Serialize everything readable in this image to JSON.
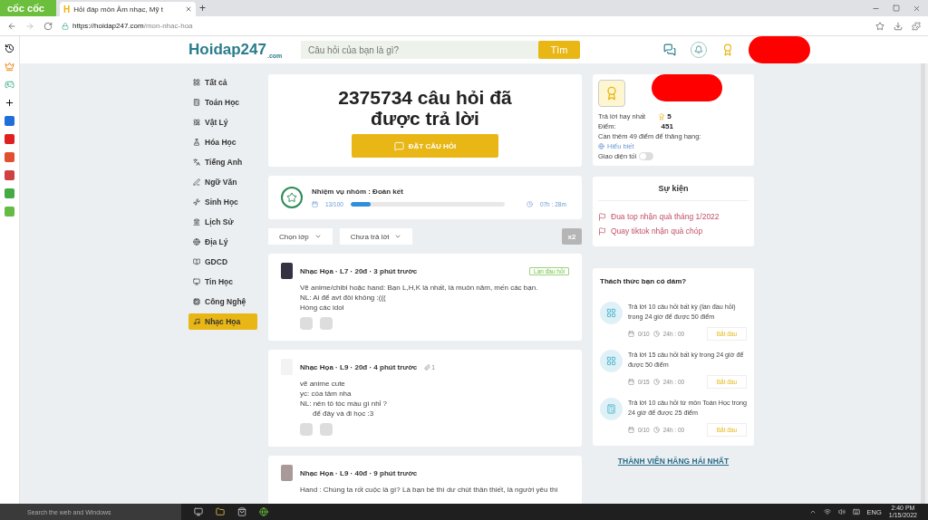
{
  "browser": {
    "brand": "cốc cốc",
    "favicon": "H",
    "tab_title": "Hỏi đáp môn Âm nhạc, Mỹ t",
    "new_tab": "+",
    "url_host": "https://hoidap247.com",
    "url_path": "/mon-nhac-hoa"
  },
  "header": {
    "logo": "Hoidap247",
    "logo_sub": ".com",
    "search_placeholder": "Câu hỏi của bạn là gì?",
    "search_button": "Tìm"
  },
  "nav": [
    {
      "label": "Tất cả",
      "selected": false
    },
    {
      "label": "Toán Học",
      "selected": false
    },
    {
      "label": "Vật Lý",
      "selected": false
    },
    {
      "label": "Hóa Học",
      "selected": false
    },
    {
      "label": "Tiếng Anh",
      "selected": false
    },
    {
      "label": "Ngữ Văn",
      "selected": false
    },
    {
      "label": "Sinh Học",
      "selected": false
    },
    {
      "label": "Lịch Sử",
      "selected": false
    },
    {
      "label": "Địa Lý",
      "selected": false
    },
    {
      "label": "GDCD",
      "selected": false
    },
    {
      "label": "Tin Học",
      "selected": false
    },
    {
      "label": "Công Nghệ",
      "selected": false
    },
    {
      "label": "Nhạc Họa",
      "selected": true
    }
  ],
  "stats": {
    "headline": "2375734 câu hỏi đã được trả lời",
    "ask_button": "ĐẶT CÂU HỎI"
  },
  "mission": {
    "title": "Nhiệm vụ nhóm : Đoàn kết",
    "progress": "13/100",
    "level": 0.13,
    "time": "07h : 28m"
  },
  "filters": [
    {
      "label": "Chọn lớp"
    },
    {
      "label": "Chưa trả lời"
    }
  ],
  "multiplier": "x2",
  "posts": [
    {
      "meta": "Nhạc Họa · L7 · 20đ · 3 phút trước",
      "badge": "Lần đầu hỏi",
      "lines": [
        {
          "text": "Vẽ anime/chibi hoặc hand: Bạn L,H,K là nhất, là muôn năm, mến các bạn.",
          "indent": false
        },
        {
          "text": "NL: Ai để avt đôi không :(((",
          "indent": false
        },
        {
          "text": "Hóng các idol",
          "indent": false
        }
      ],
      "reactions": [
        {
          "kind": "sticker"
        },
        {
          "kind": "sticker"
        }
      ]
    },
    {
      "meta": "Nhạc Họa · L9 · 20đ · 4 phút trước",
      "attachments": "1",
      "lines": [
        {
          "text": "vẽ anime cute",
          "indent": false
        },
        {
          "text": "yc: cóa tâm nha",
          "indent": false
        },
        {
          "text": "NL: nên tô tóc màu gì nhỉ ?",
          "indent": false
        },
        {
          "text": "để đây và đi học :3",
          "indent": true
        }
      ],
      "reactions": [
        {
          "kind": "sticker"
        },
        {
          "kind": "sticker"
        }
      ]
    },
    {
      "meta": "Nhạc Họa · L9 · 40đ · 9 phút trước",
      "lines": [
        {
          "text": "Hand : Chúng ta rốt cuộc là gì? Là bạn bè thì dư chút thân thiết, là người yêu thì",
          "indent": false
        }
      ]
    }
  ],
  "profile": {
    "best_label": "Trả lời hay nhất",
    "best": "5",
    "points_label": "Điểm:",
    "points": "451",
    "rank_note": "Cần thêm 49 điểm để thăng hạng:",
    "rank": "Hiểu biết",
    "dark_label": "Giao diện tối",
    "dark_on": false
  },
  "events": {
    "title": "Sự kiện",
    "items": [
      "Đua top nhận quà tháng 1/2022",
      "Quay tiktok nhận quà chóp"
    ]
  },
  "challenges": {
    "title": "Thách thức bạn có dám?",
    "items": [
      {
        "kind": "any",
        "text": "Trả lời 10 câu hỏi  bất kỳ (lần đầu hỏi) trong 24 giờ để được 50 điểm",
        "progress": "0/10",
        "time": "24h : 00",
        "button": "Bắt đầu"
      },
      {
        "kind": "any",
        "text": "Trả lời 15 câu hỏi  bất kỳ  trong 24 giờ để được 50 điểm",
        "progress": "0/15",
        "time": "24h : 00",
        "button": "Bắt đầu"
      },
      {
        "kind": "subject",
        "text": "Trả lời 10 câu hỏi  từ môn Toán Học trong 24 giờ để được 25 điểm",
        "progress": "0/10",
        "time": "24h : 00",
        "button": "Bắt đầu"
      }
    ]
  },
  "members_link": "THÀNH VIÊN HĂNG HÁI NHẤT",
  "taskbar": {
    "search_placeholder": "Search the web and Windows",
    "lang": "ENG",
    "time": "2:40 PM",
    "date": "1/15/2022"
  }
}
